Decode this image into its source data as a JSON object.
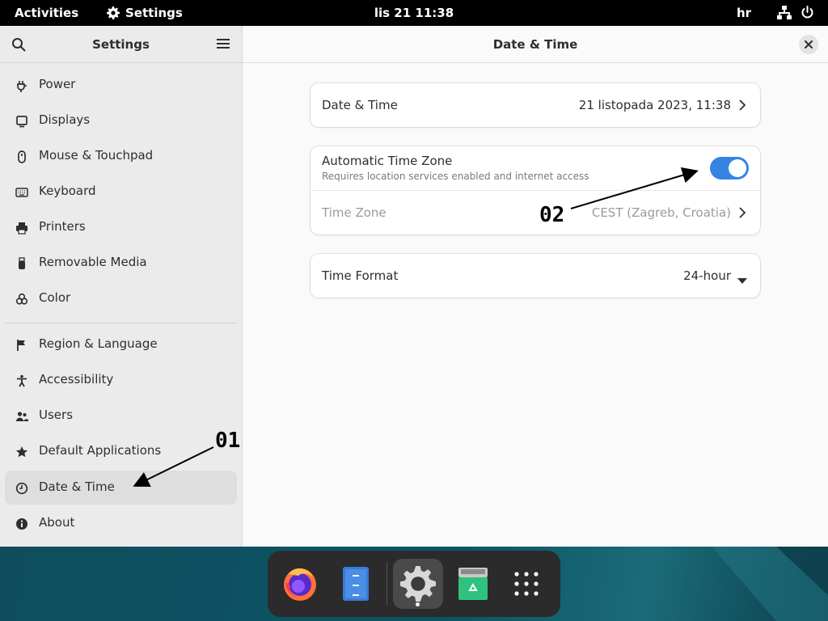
{
  "topbar": {
    "activities": "Activities",
    "app_name": "Settings",
    "clock": "lis 21 11:38",
    "language": "hr"
  },
  "sidebar": {
    "title": "Settings",
    "items": [
      {
        "label": "Power",
        "icon": "power-plug-icon"
      },
      {
        "label": "Displays",
        "icon": "display-icon"
      },
      {
        "label": "Mouse & Touchpad",
        "icon": "mouse-icon"
      },
      {
        "label": "Keyboard",
        "icon": "keyboard-icon"
      },
      {
        "label": "Printers",
        "icon": "printer-icon"
      },
      {
        "label": "Removable Media",
        "icon": "usb-icon"
      },
      {
        "label": "Color",
        "icon": "color-icon"
      },
      {
        "label": "Region & Language",
        "icon": "flag-icon"
      },
      {
        "label": "Accessibility",
        "icon": "accessibility-icon"
      },
      {
        "label": "Users",
        "icon": "users-icon"
      },
      {
        "label": "Default Applications",
        "icon": "star-icon"
      },
      {
        "label": "Date & Time",
        "icon": "clock-icon",
        "active": true
      },
      {
        "label": "About",
        "icon": "info-icon"
      }
    ]
  },
  "main": {
    "title": "Date & Time",
    "date_time": {
      "label": "Date & Time",
      "value": "21 listopada 2023, 11:38"
    },
    "auto_timezone": {
      "label": "Automatic Time Zone",
      "subtitle": "Requires location services enabled and internet access",
      "enabled": true
    },
    "time_zone": {
      "label": "Time Zone",
      "value": "CEST (Zagreb, Croatia)"
    },
    "time_format": {
      "label": "Time Format",
      "value": "24-hour"
    }
  },
  "annotations": {
    "a1": "01",
    "a2": "02"
  },
  "dock": {
    "apps": [
      "firefox-icon",
      "files-icon",
      "settings-icon",
      "recycle-bin-icon",
      "app-grid-icon"
    ]
  },
  "colors": {
    "accent": "#3584e4",
    "topbar": "#000000",
    "dock": "#2b2b2b"
  }
}
